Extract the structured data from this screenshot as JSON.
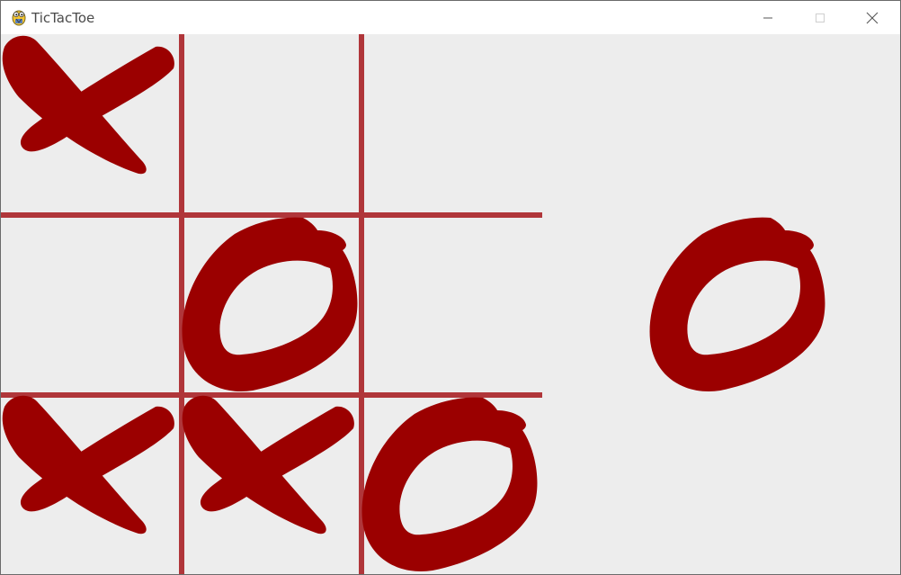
{
  "window": {
    "title": "TicTacToe",
    "icon": "python-snake-icon"
  },
  "controls": {
    "minimize_icon": "minimize-icon",
    "maximize_icon": "maximize-icon",
    "close_icon": "close-icon"
  },
  "colors": {
    "mark": "#9b0000",
    "grid": "#b0363a",
    "background": "#ededed"
  },
  "board": {
    "cells": [
      [
        "X",
        "",
        ""
      ],
      [
        "",
        "O",
        ""
      ],
      [
        "X",
        "X",
        "O"
      ]
    ]
  },
  "turn": {
    "current_mark": "O"
  }
}
